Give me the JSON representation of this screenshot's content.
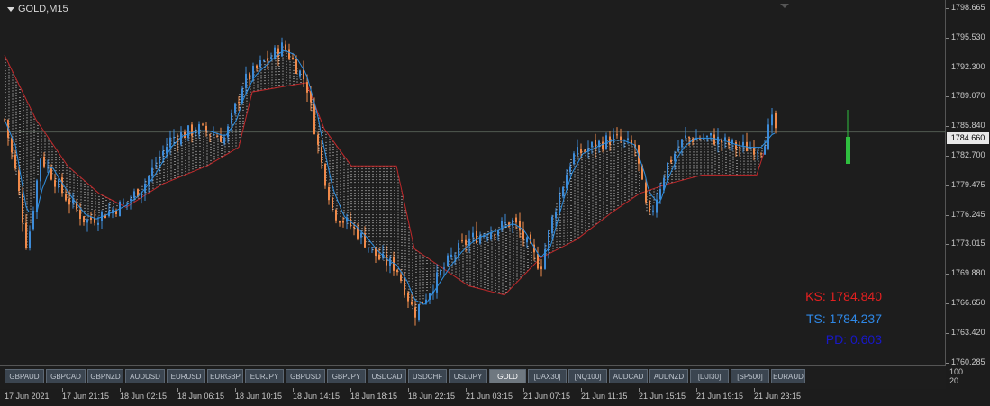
{
  "chart": {
    "symbol": "GOLD,M15",
    "current_price": "1784.660",
    "colors": {
      "background": "#1d1d1d",
      "bull": "#3d8bd8",
      "bear": "#f08a4a",
      "cloud_dots": "#ffffff",
      "cloud_edge": "#c0282a",
      "ma_line": "#2f8fe0",
      "volume_bar": "#2fbf3f",
      "price_line": "#505a50"
    },
    "price_axis": [
      "1798.665",
      "1795.530",
      "1792.300",
      "1789.070",
      "1785.840",
      "1782.700",
      "1779.475",
      "1776.245",
      "1773.015",
      "1769.880",
      "1766.650",
      "1763.420",
      "1760.285"
    ],
    "volume_axis": [
      "100",
      "20"
    ]
  },
  "indicators": {
    "ks_label": "KS: 1784.840",
    "ts_label": "TS: 1784.237",
    "pd_label": "PD: 0.603",
    "ks_color": "#e42020",
    "ts_color": "#2f88e6",
    "pd_color": "#1818c8"
  },
  "tabs": [
    "GBPAUD",
    "GBPCAD",
    "GBPNZD",
    "AUDUSD",
    "EURUSD",
    "EURGBP",
    "EURJPY",
    "GBPUSD",
    "GBPJPY",
    "USDCAD",
    "USDCHF",
    "USDJPY",
    "GOLD",
    "[DAX30]",
    "[NQ100]",
    "AUDCAD",
    "AUDNZD",
    "[DJI30]",
    "[SP500]",
    "EURAUD"
  ],
  "active_tab": "GOLD",
  "time_axis": [
    "17 Jun 2021",
    "17 Jun 21:15",
    "18 Jun 02:15",
    "18 Jun 06:15",
    "18 Jun 10:15",
    "18 Jun 14:15",
    "18 Jun 18:15",
    "18 Jun 22:15",
    "21 Jun 03:15",
    "21 Jun 07:15",
    "21 Jun 11:15",
    "21 Jun 15:15",
    "21 Jun 19:15",
    "21 Jun 23:15"
  ]
}
